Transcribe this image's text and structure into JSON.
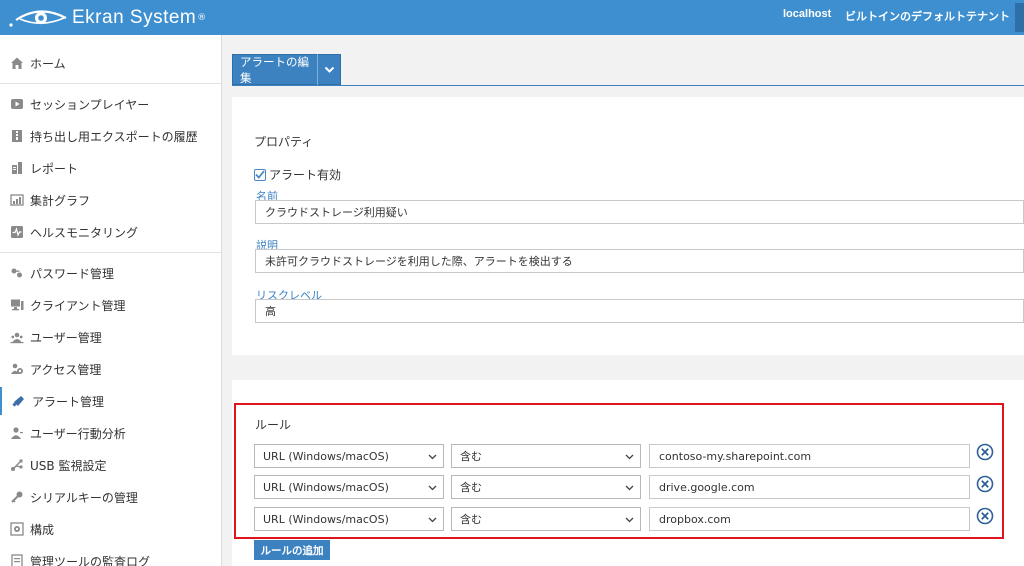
{
  "header": {
    "brand": "Ekran System",
    "reg_mark": "®",
    "host": "localhost",
    "tenant": "ビルトインのデフォルトテナント",
    "bg_color": "#3e8fd0"
  },
  "sidebar": {
    "items": [
      {
        "label": "ホーム",
        "icon": "home-icon"
      },
      {
        "label": "セッションプレイヤー",
        "icon": "play-icon"
      },
      {
        "label": "持ち出し用エクスポートの履歴",
        "icon": "archive-icon"
      },
      {
        "label": "レポート",
        "icon": "report-icon"
      },
      {
        "label": "集計グラフ",
        "icon": "chart-icon"
      },
      {
        "label": "ヘルスモニタリング",
        "icon": "health-icon"
      },
      {
        "label": "パスワード管理",
        "icon": "keys-icon"
      },
      {
        "label": "クライアント管理",
        "icon": "monitor-icon"
      },
      {
        "label": "ユーザー管理",
        "icon": "users-icon"
      },
      {
        "label": "アクセス管理",
        "icon": "access-icon"
      },
      {
        "label": "アラート管理",
        "icon": "megaphone-icon"
      },
      {
        "label": "ユーザー行動分析",
        "icon": "user-analytics-icon"
      },
      {
        "label": "USB 監視設定",
        "icon": "usb-icon"
      },
      {
        "label": "シリアルキーの管理",
        "icon": "key-icon"
      },
      {
        "label": "構成",
        "icon": "config-icon"
      },
      {
        "label": "管理ツールの監査ログ",
        "icon": "audit-icon"
      }
    ]
  },
  "tab": {
    "label": "アラートの編集"
  },
  "properties": {
    "title": "プロパティ",
    "enabled_label": "アラート有効",
    "name_label": "名前",
    "name_value": "クラウドストレージ利用疑い",
    "desc_label": "説明",
    "desc_value": "未許可クラウドストレージを利用した際、アラートを検出する",
    "risk_label": "リスクレベル",
    "risk_value": "高"
  },
  "rules": {
    "title": "ルール",
    "items": [
      {
        "field": "URL (Windows/macOS)",
        "op": "含む",
        "value": "contoso-my.sharepoint.com"
      },
      {
        "field": "URL (Windows/macOS)",
        "op": "含む",
        "value": "drive.google.com"
      },
      {
        "field": "URL (Windows/macOS)",
        "op": "含む",
        "value": "dropbox.com"
      }
    ],
    "add_label": "ルールの追加",
    "highlight_color": "#e0141c"
  }
}
